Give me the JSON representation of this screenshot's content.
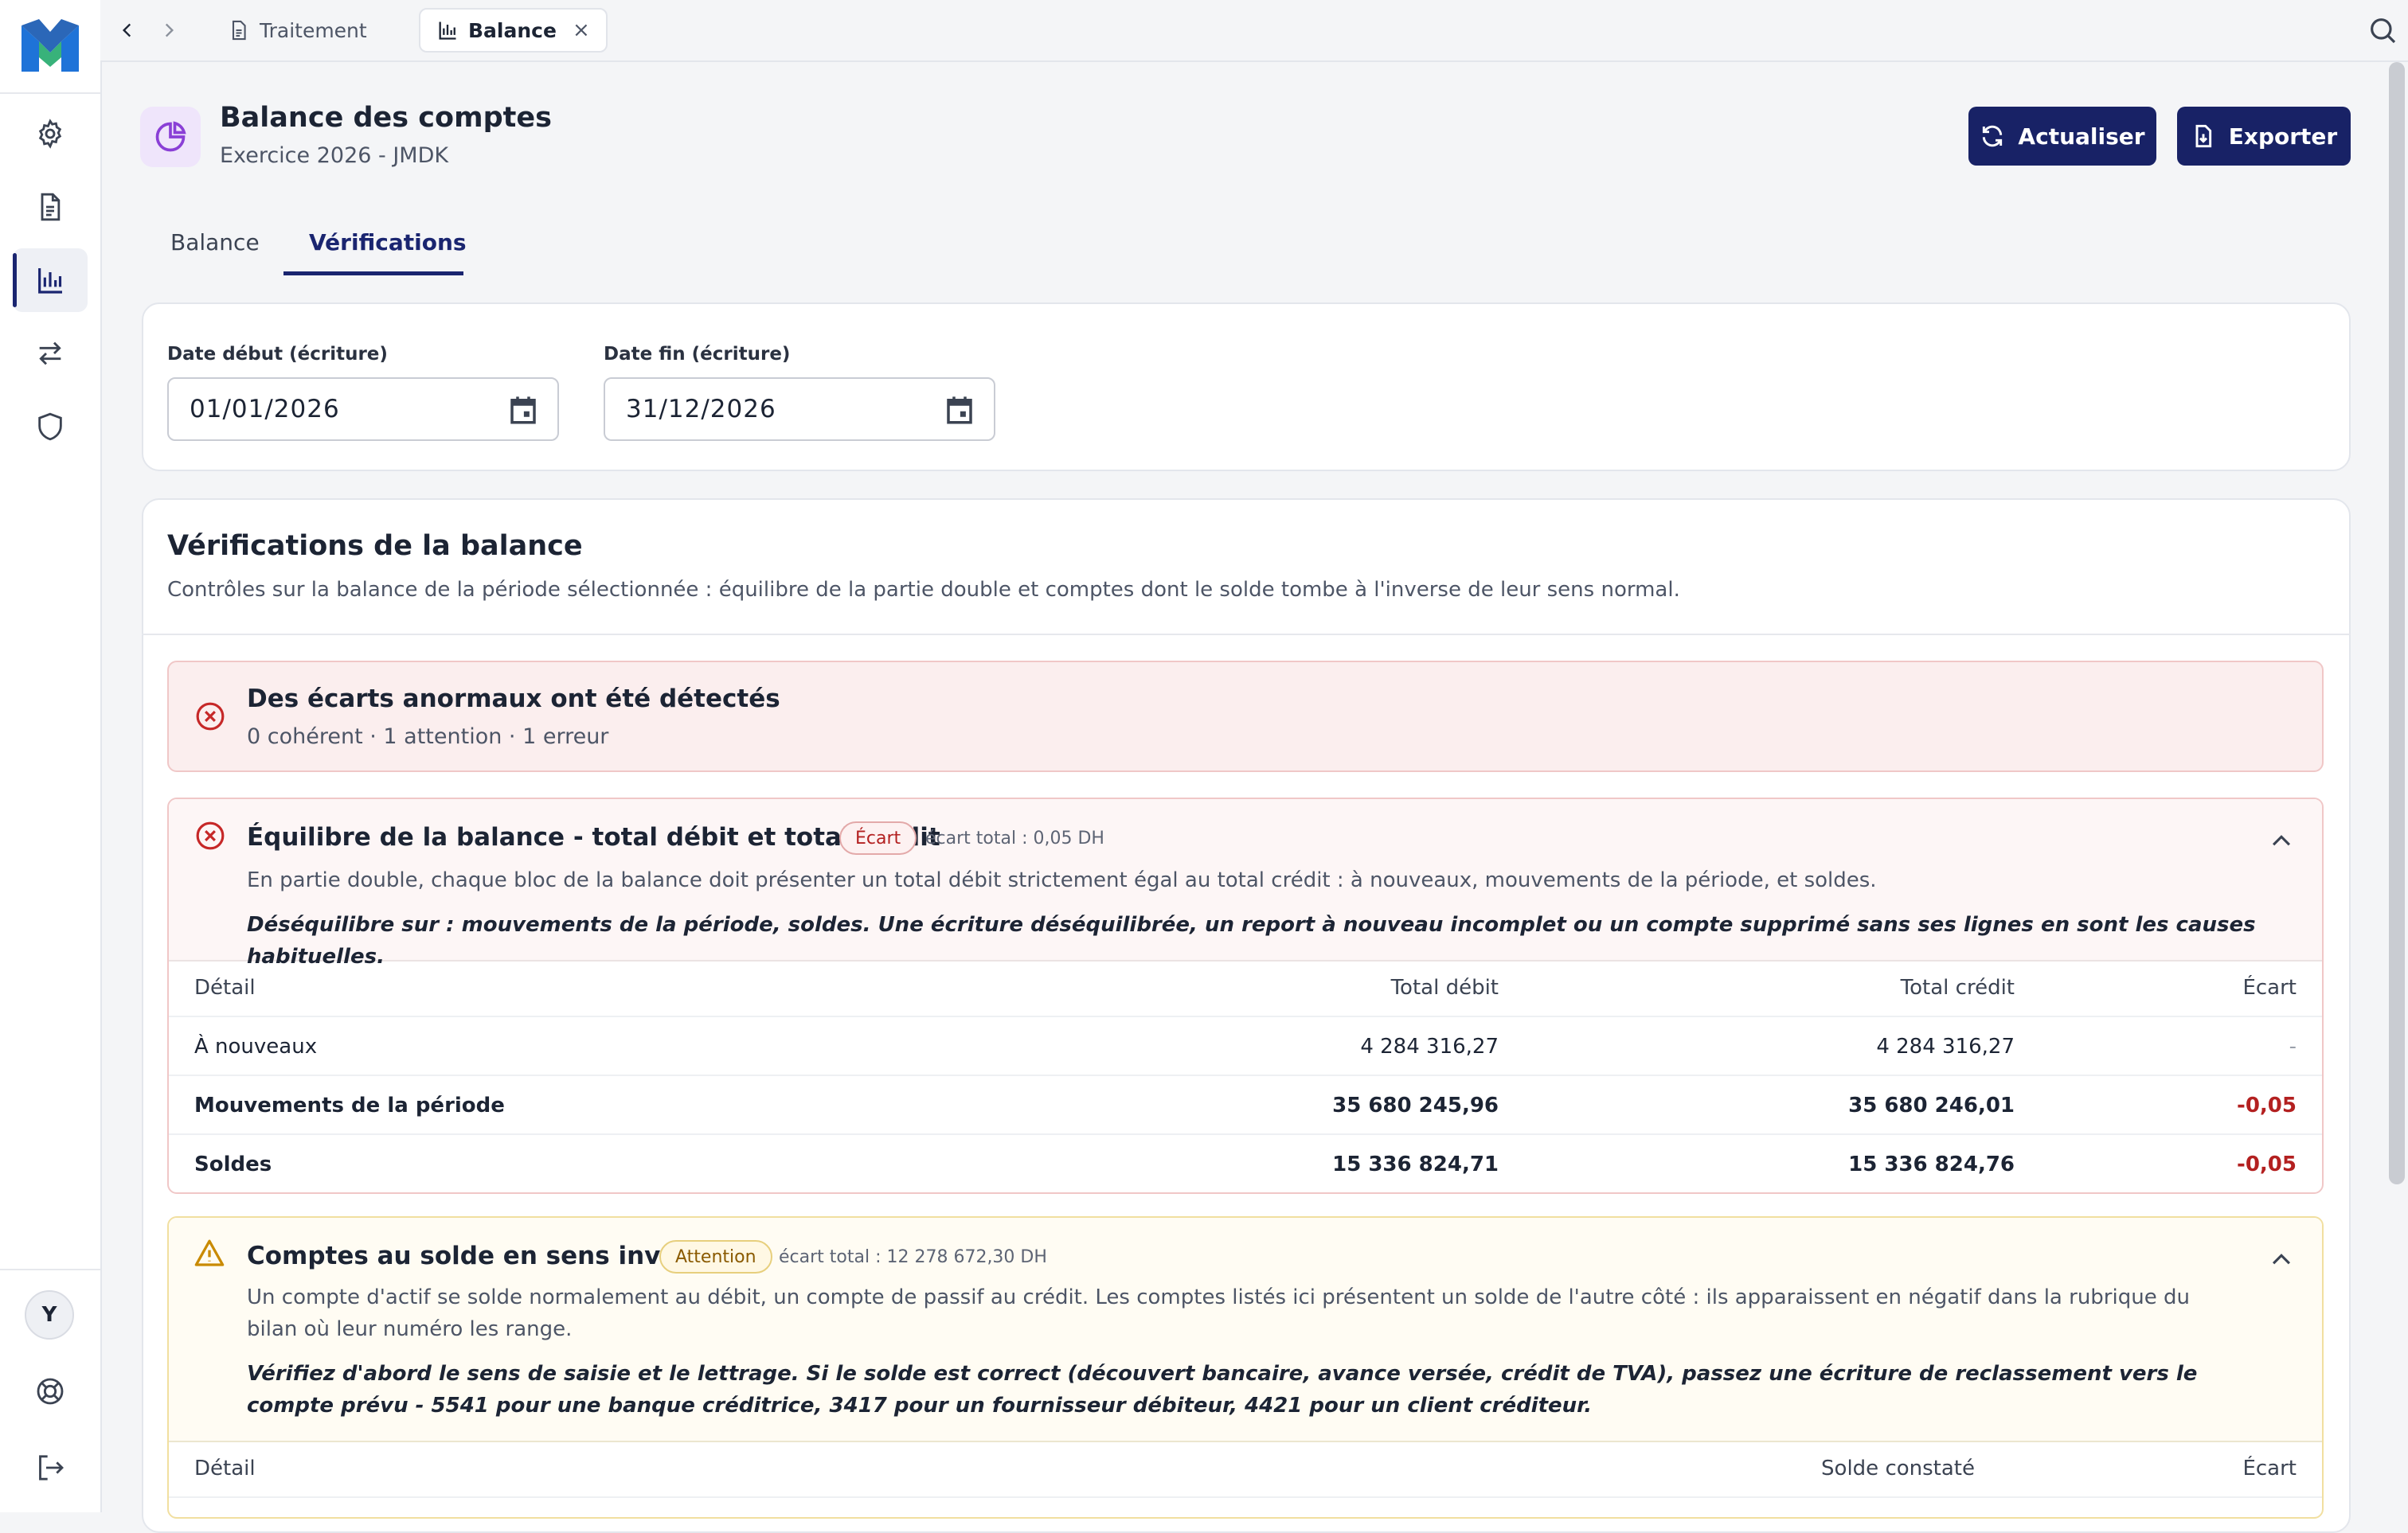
{
  "topbar": {
    "tabs": [
      {
        "label": "Traitement",
        "icon": "document-icon",
        "active": false
      },
      {
        "label": "Balance",
        "icon": "bar-chart-icon",
        "active": true
      }
    ],
    "close_label": "×"
  },
  "sidebar": {
    "avatar_initial": "Y",
    "items": [
      "settings-icon",
      "document-icon",
      "bar-chart-icon",
      "transfer-icon",
      "shield-icon"
    ],
    "active_item": "bar-chart-icon",
    "bottom": [
      "help-icon",
      "logout-icon"
    ]
  },
  "header": {
    "title": "Balance des comptes",
    "subtitle": "Exercice 2026 - JMDK",
    "refresh_label": "Actualiser",
    "export_label": "Exporter"
  },
  "subtabs": [
    {
      "label": "Balance",
      "active": false
    },
    {
      "label": "Vérifications",
      "active": true
    }
  ],
  "filters": {
    "start_label": "Date début (écriture)",
    "start_value": "01/01/2026",
    "end_label": "Date fin (écriture)",
    "end_value": "31/12/2026"
  },
  "verifications": {
    "title": "Vérifications de la balance",
    "description": "Contrôles sur la balance de la période sélectionnée : équilibre de la partie double et comptes dont le solde tombe à l'inverse de leur sens normal.",
    "summary": {
      "title": "Des écarts anormaux ont été détectés",
      "subtitle": "0 cohérent · 1 attention · 1 erreur"
    },
    "checks": [
      {
        "title": "Équilibre de la balance - total débit et total crédit",
        "badge": "Écart",
        "meta": "écart total : 0,05 DH",
        "description": "En partie double, chaque bloc de la balance doit présenter un total débit strictement égal au total crédit : à nouveaux, mouvements de la période, et soldes.",
        "note": "Déséquilibre sur : mouvements de la période, soldes. Une écriture déséquilibrée, un report à nouveau incomplet ou un compte supprimé sans ses lignes en sont les causes habituelles.",
        "columns": [
          "Détail",
          "Total débit",
          "Total crédit",
          "Écart"
        ],
        "rows": [
          {
            "label": "À nouveaux",
            "debit": "4 284 316,27",
            "credit": "4 284 316,27",
            "ecart": "-"
          },
          {
            "label": "Mouvements de la période",
            "debit": "35 680 245,96",
            "credit": "35 680 246,01",
            "ecart": "-0,05"
          },
          {
            "label": "Soldes",
            "debit": "15 336 824,71",
            "credit": "15 336 824,76",
            "ecart": "-0,05"
          }
        ]
      },
      {
        "title": "Comptes au solde en sens inverse",
        "badge": "Attention",
        "meta": "écart total : 12 278 672,30 DH",
        "description": "Un compte d'actif se solde normalement au débit, un compte de passif au crédit. Les comptes listés ici présentent un solde de l'autre côté : ils apparaissent en négatif dans la rubrique du bilan où leur numéro les range.",
        "note": "Vérifiez d'abord le sens de saisie et le lettrage. Si le solde est correct (découvert bancaire, avance versée, crédit de TVA), passez une écriture de reclassement vers le compte prévu - 5541 pour une banque créditrice, 3417 pour un fournisseur débiteur, 4421 pour un client créditeur.",
        "columns": [
          "Détail",
          "Solde constaté",
          "Écart"
        ]
      }
    ]
  },
  "colors": {
    "primary": "#182266",
    "error": "#b32020",
    "warning": "#c98a00",
    "accent_purple": "#8a3fd6"
  }
}
